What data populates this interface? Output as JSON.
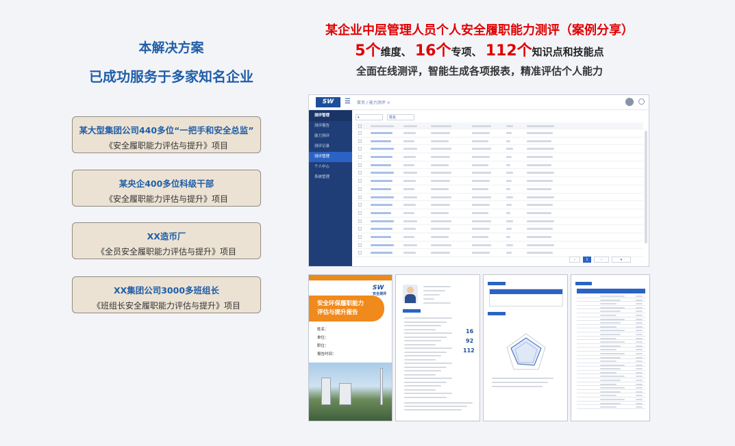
{
  "left": {
    "title1": "本解决方案",
    "title2": "已成功服务于多家知名企业",
    "cases": [
      {
        "name": "某大型集团公司440多位“一把手和安全总监”",
        "project": "《安全履职能力评估与提升》项目"
      },
      {
        "name": "某央企400多位科级干部",
        "project": "《安全履职能力评估与提升》项目"
      },
      {
        "name": "XX造币厂",
        "project": "《全员安全履职能力评估与提升》项目"
      },
      {
        "name": "XX集团公司3000多班组长",
        "project": "《班组长安全履职能力评估与提升》项目"
      }
    ]
  },
  "headline": {
    "title": "某企业中层管理人员个人安全履职能力测评（案例分享）",
    "stat1_num": "5个",
    "stat1_text": "维度、",
    "stat2_num": "16个",
    "stat2_text": "专项、",
    "stat3_num": "112个",
    "stat3_text": "知识点和技能点",
    "subtitle": "全面在线测评，智能生成各项报表，精准评估个人能力"
  },
  "app": {
    "logo": "SW",
    "crumb": "首页 / 能力测评  ×",
    "menu_title": "测评管理",
    "menu": [
      "测评管理",
      "测评报告",
      "能力测评",
      "测评记录",
      "个人中心",
      "系统管理"
    ],
    "search_placeholder": "姓名"
  },
  "report": {
    "logo": "SW",
    "logo_sub": "安全测评",
    "title_line1": "安全环保履职能力",
    "title_line2": "评估与提升报告",
    "info": [
      "姓名：",
      "单位：",
      "职位：",
      "报告时间："
    ],
    "scores": [
      "16",
      "92",
      "112"
    ]
  },
  "colors": {
    "accent": "#1f5ea8",
    "red": "#e00000",
    "orange": "#f08a1c",
    "card_bg": "#ece2d3"
  }
}
